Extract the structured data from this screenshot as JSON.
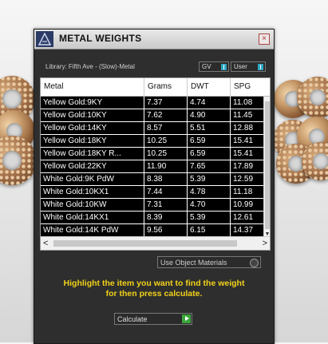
{
  "window": {
    "title": "METAL WEIGHTS",
    "close_label": "×"
  },
  "library": {
    "label": "Library: Fifth Ave - (Slow)-Metal"
  },
  "toggles": {
    "gv_label": "GV",
    "user_label": "User"
  },
  "table": {
    "headers": [
      "Metal",
      "Grams",
      "DWT",
      "SPG"
    ],
    "rows": [
      [
        "Yellow Gold:9KY",
        "7.37",
        "4.74",
        "11.08"
      ],
      [
        "Yellow Gold:10KY",
        "7.62",
        "4.90",
        "11.45"
      ],
      [
        "Yellow Gold:14KY",
        "8.57",
        "5.51",
        "12.88"
      ],
      [
        "Yellow Gold:18KY",
        "10.25",
        "6.59",
        "15.41"
      ],
      [
        "Yellow Gold:18KY R...",
        "10.25",
        "6.59",
        "15.41"
      ],
      [
        "Yellow Gold:22KY",
        "11.90",
        "7.65",
        "17.89"
      ],
      [
        "White Gold:9K PdW",
        "8.38",
        "5.39",
        "12.59"
      ],
      [
        "White Gold:10KX1",
        "7.44",
        "4.78",
        "11.18"
      ],
      [
        "White Gold:10KW",
        "7.31",
        "4.70",
        "10.99"
      ],
      [
        "White Gold:14KX1",
        "8.39",
        "5.39",
        "12.61"
      ],
      [
        "White Gold:14K PdW",
        "9.56",
        "6.15",
        "14.37"
      ]
    ]
  },
  "scrollbar": {
    "left_arrow": "<",
    "right_arrow": ">",
    "down_arrow": "▼"
  },
  "options": {
    "use_object_materials_label": "Use Object Materials"
  },
  "hint": {
    "line1": "Highlight the item you want to find the weight",
    "line2": "for then press calculate."
  },
  "calculate": {
    "label": "Calculate"
  },
  "colors": {
    "hint_yellow": "#f2d21a",
    "toggle_accent": "#2fa6c2",
    "calculate_green": "#3ba53b",
    "panel_bg": "#2e2e2e"
  }
}
